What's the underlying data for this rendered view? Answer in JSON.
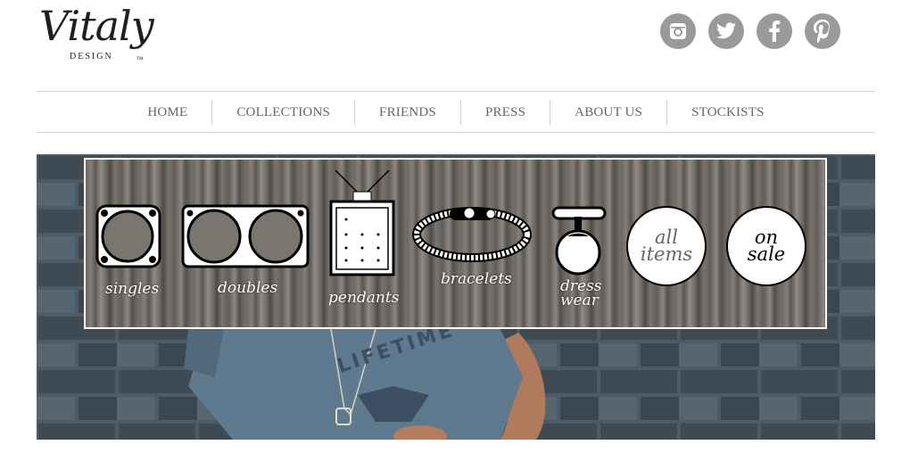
{
  "logo": {
    "script": "Vitaly",
    "sub": "DESIGN",
    "tm": "TM"
  },
  "social": [
    {
      "name": "instagram-icon",
      "glyph": "◘"
    },
    {
      "name": "twitter-icon",
      "glyph": "🐦"
    },
    {
      "name": "facebook-icon",
      "glyph": "f"
    },
    {
      "name": "pinterest-icon",
      "glyph": "p"
    }
  ],
  "nav": [
    "HOME",
    "COLLECTIONS",
    "FRIENDS",
    "PRESS",
    "ABOUT US",
    "STOCKISTS"
  ],
  "categories": {
    "singles": "singles",
    "doubles": "doubles",
    "pendants": "pendants",
    "bracelets": "bracelets",
    "dress_line1": "dress",
    "dress_line2": "wear",
    "all_line1": "all",
    "all_line2": "items",
    "sale_line1": "on",
    "sale_line2": "sale"
  },
  "shirt_text": "LIFETIME"
}
